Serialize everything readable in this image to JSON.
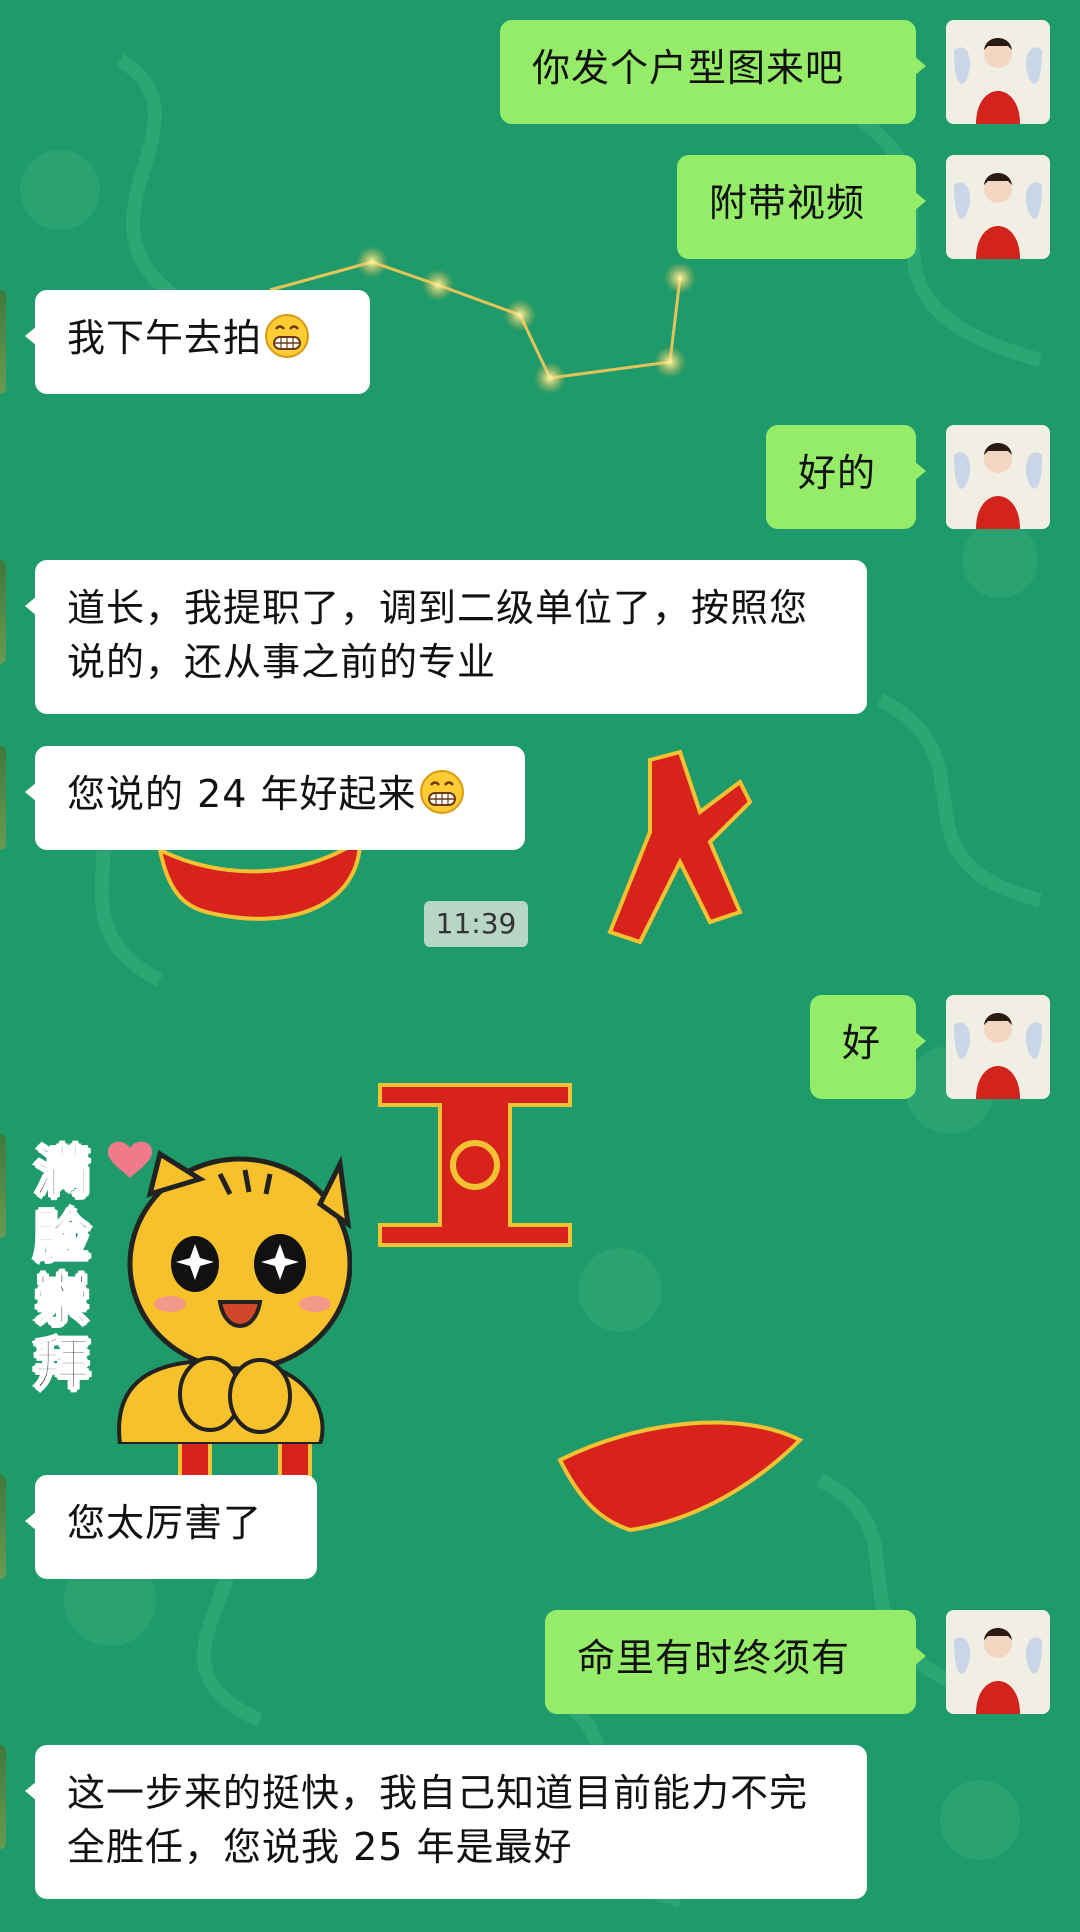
{
  "messages": [
    {
      "side": "right",
      "text": "你发个户型图来吧"
    },
    {
      "side": "right",
      "text": "附带视频"
    },
    {
      "side": "left",
      "text": "我下午去拍"
    },
    {
      "side": "right",
      "text": "好的"
    },
    {
      "side": "left",
      "text": "道长，我提职了，调到二级单位了，按照您说的，还从事之前的专业"
    },
    {
      "side": "left",
      "text": "您说的 24 年好起来"
    },
    {
      "side": "right",
      "text": "好"
    },
    {
      "side": "left",
      "text": "您太厉害了"
    },
    {
      "side": "right",
      "text": "命里有时终须有"
    },
    {
      "side": "left",
      "text": "这一步来的挺快，我自己知道目前能力不完全胜任，您说我 25 年是最好"
    }
  ],
  "timestamp": "11:39",
  "sticker": {
    "text": "满脸崇拜",
    "icon": "cartoon-cat-sticker"
  },
  "emoji": "grinning-face-emoji",
  "colors": {
    "background": "#1f9a6a",
    "bubble_right": "#95ec69",
    "bubble_left": "#ffffff",
    "decor_red": "#d8231c"
  }
}
